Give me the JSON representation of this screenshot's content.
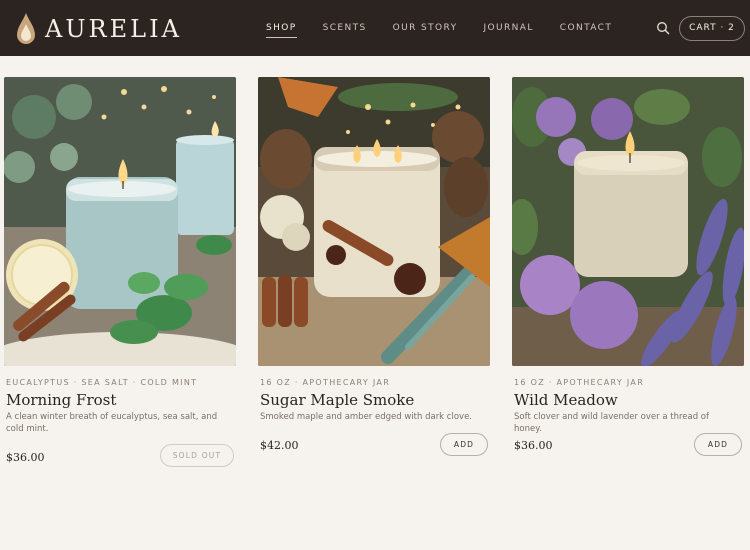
{
  "brand": {
    "name": "AURELIA",
    "logo": "flame-drop-icon"
  },
  "nav": {
    "items": [
      "SHOP",
      "SCENTS",
      "OUR STORY",
      "JOURNAL",
      "CONTACT"
    ],
    "active": "SHOP"
  },
  "header": {
    "search_icon": "search-icon",
    "cart_label": "CART · 2"
  },
  "colors": {
    "header_bg": "#2b2420",
    "page_bg": "#f6f2ee",
    "text": "#2a2420",
    "muted": "#8b8178"
  },
  "products": [
    {
      "meta": "EUCALYPTUS · SEA SALT · COLD MINT",
      "name": "Morning Frost",
      "description": "A clean winter breath of eucalyptus, sea salt, and cold mint.",
      "price": "$36.00",
      "action": "SOLD OUT",
      "sold_out": true
    },
    {
      "meta": "16 OZ · APOTHECARY JAR",
      "name": "Sugar Maple Smoke",
      "description": "Smoked maple and amber edged with dark clove.",
      "price": "$42.00",
      "action": "ADD",
      "sold_out": false
    },
    {
      "meta": "16 OZ · APOTHECARY JAR",
      "name": "Wild Meadow",
      "description": "Soft clover and wild lavender over a thread of honey.",
      "price": "$36.00",
      "action": "ADD",
      "sold_out": false
    }
  ]
}
